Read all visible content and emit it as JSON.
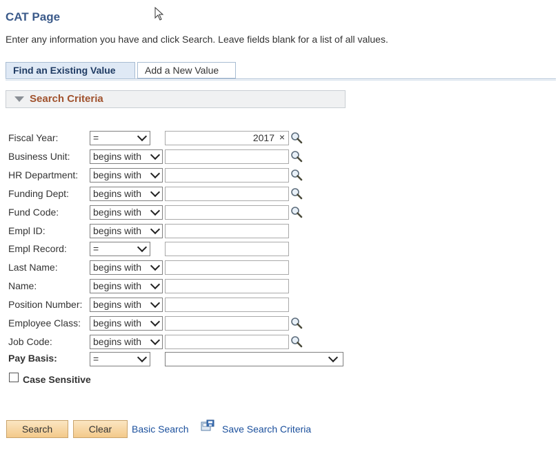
{
  "page": {
    "title": "CAT Page",
    "instructions": "Enter any information you have and click Search. Leave fields blank for a list of all values."
  },
  "tabs": [
    {
      "label": "Find an Existing Value",
      "active": true
    },
    {
      "label": "Add a New Value",
      "active": false
    }
  ],
  "search_criteria": {
    "title": "Search Criteria",
    "fields": [
      {
        "label": "Fiscal Year:",
        "operator": "=",
        "value": "2017",
        "lookup": true
      },
      {
        "label": "Business Unit:",
        "operator": "begins with",
        "value": "",
        "lookup": true
      },
      {
        "label": "HR Department:",
        "operator": "begins with",
        "value": "",
        "lookup": true
      },
      {
        "label": "Funding Dept:",
        "operator": "begins with",
        "value": "",
        "lookup": true
      },
      {
        "label": "Fund Code:",
        "operator": "begins with",
        "value": "",
        "lookup": true
      },
      {
        "label": "Empl ID:",
        "operator": "begins with",
        "value": "",
        "lookup": false
      },
      {
        "label": "Empl Record:",
        "operator": "=",
        "value": "",
        "lookup": false
      },
      {
        "label": "Last Name:",
        "operator": "begins with",
        "value": "",
        "lookup": false
      },
      {
        "label": "Name:",
        "operator": "begins with",
        "value": "",
        "lookup": false
      },
      {
        "label": "Position Number:",
        "operator": "begins with",
        "value": "",
        "lookup": false
      },
      {
        "label": "Employee Class:",
        "operator": "begins with",
        "value": "",
        "lookup": true
      },
      {
        "label": "Job Code:",
        "operator": "begins with",
        "value": "",
        "lookup": true
      }
    ],
    "pay_basis": {
      "label": "Pay Basis:",
      "operator": "=",
      "value": ""
    },
    "case_sensitive": {
      "label": "Case Sensitive",
      "checked": false
    }
  },
  "actions": {
    "search_label": "Search",
    "clear_label": "Clear",
    "basic_search_label": "Basic Search",
    "save_criteria_label": "Save Search Criteria"
  },
  "icons": {
    "lookup": "magnifier-icon",
    "save": "save-criteria-icon",
    "cursor": "mouse-pointer-icon"
  },
  "colors": {
    "title": "#3b5a8a",
    "criteria_title": "#a0522d",
    "link": "#1a4f9c",
    "button": "#f3c98a"
  }
}
